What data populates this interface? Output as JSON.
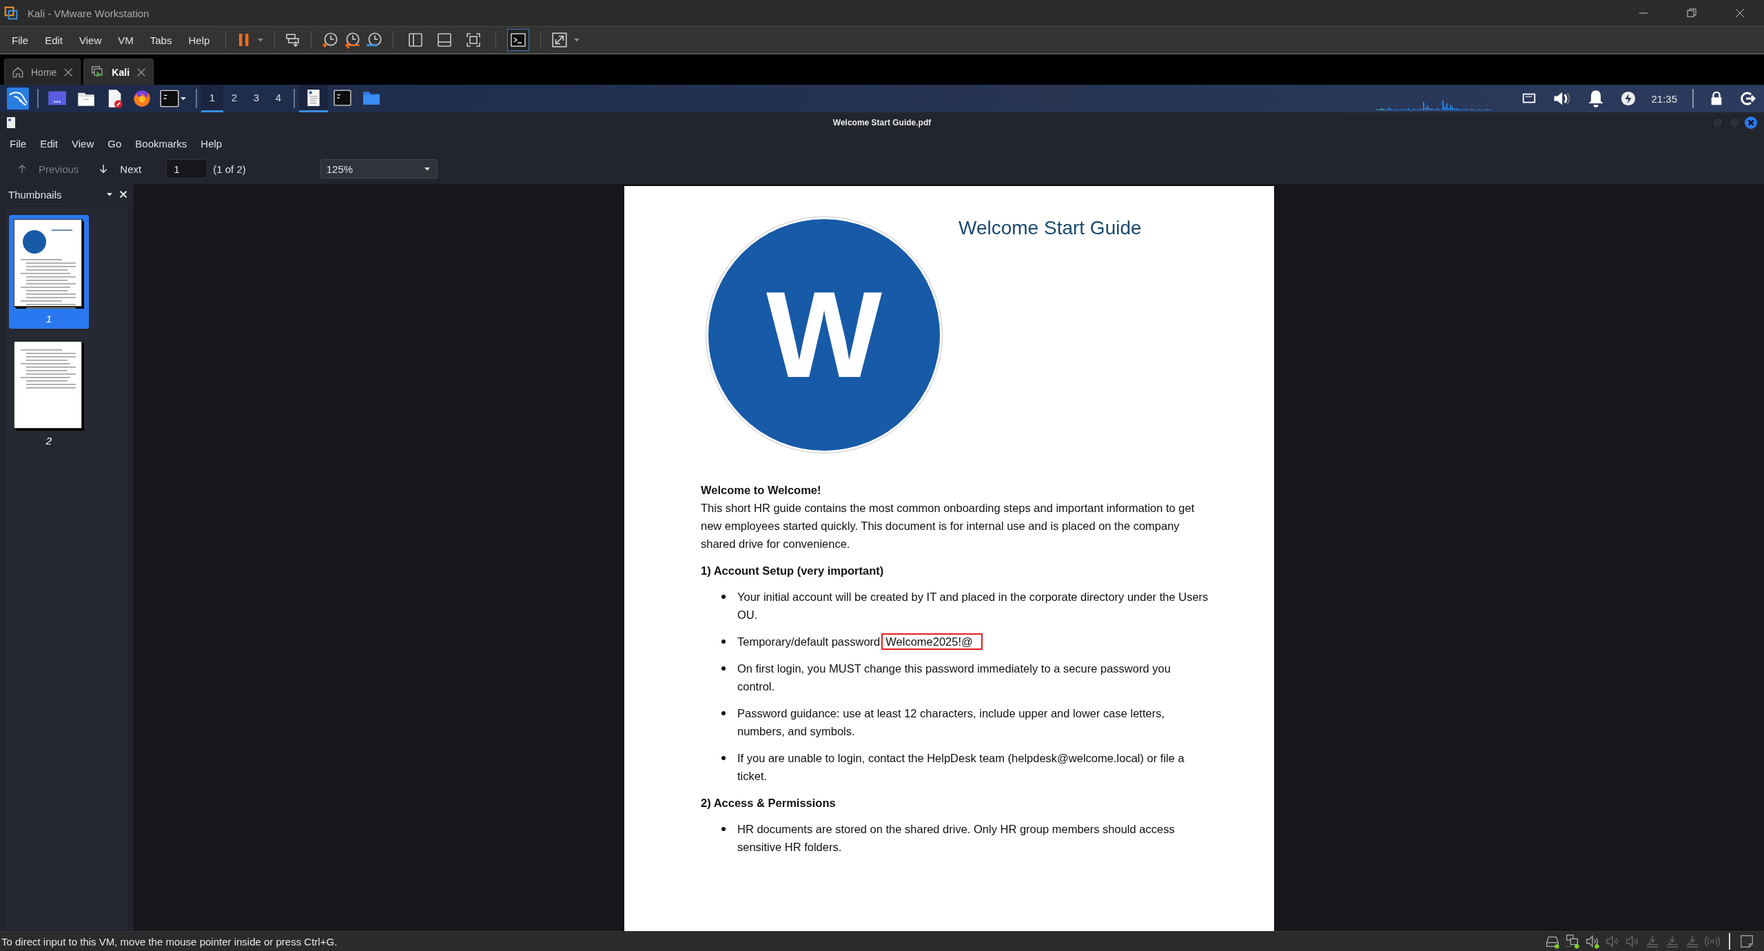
{
  "window": {
    "title": "Kali - VMware Workstation"
  },
  "menu": [
    "File",
    "Edit",
    "View",
    "VM",
    "Tabs",
    "Help"
  ],
  "vm_toolbar": {
    "view_buttons": [
      {
        "kind": "sidebar",
        "selected": false
      },
      {
        "kind": "bottom",
        "selected": false
      },
      {
        "kind": "fullscreen",
        "selected": false
      },
      {
        "kind": "console",
        "selected": true
      }
    ]
  },
  "vm_tabs": [
    {
      "kind": "home",
      "label": "Home",
      "selected": false
    },
    {
      "kind": "vm",
      "label": "Kali",
      "selected": true
    }
  ],
  "panel": {
    "workspaces": [
      {
        "label": "1",
        "selected": true
      },
      {
        "label": "2",
        "selected": false
      },
      {
        "label": "3",
        "selected": false
      },
      {
        "label": "4",
        "selected": false
      }
    ],
    "tasks": [
      {
        "kind": "document",
        "selected": true
      },
      {
        "kind": "terminal",
        "selected": false
      },
      {
        "kind": "folder",
        "selected": false
      }
    ],
    "clock": "21:35"
  },
  "viewer": {
    "title": "Welcome Start Guide.pdf",
    "menu": [
      "File",
      "Edit",
      "View",
      "Go",
      "Bookmarks",
      "Help"
    ],
    "previous": {
      "label": "Previous",
      "disabled": true
    },
    "next": {
      "label": "Next",
      "disabled": false
    },
    "page_field": "1",
    "page_count": "(1 of 2)",
    "zoom": "125%",
    "sidebar": {
      "title": "Thumbnails",
      "thumbnails": [
        {
          "kind": "cover",
          "label": "1",
          "selected": true
        },
        {
          "kind": "text",
          "label": "2",
          "selected": false
        }
      ]
    },
    "document": {
      "title": "Welcome Start Guide",
      "logo_letter": "W",
      "blocks": [
        {
          "kind": "heading",
          "text": "Welcome to Welcome!"
        },
        {
          "kind": "paragraph",
          "text": "This short HR guide contains the most common onboarding steps and important information to get new employees started quickly. This document is for internal use and is placed on the company shared drive for convenience."
        },
        {
          "kind": "heading",
          "text": "1) Account Setup (very important)"
        },
        {
          "kind": "bullets",
          "items": [
            {
              "text": "Your initial account will be created by IT and placed in the corporate directory under the Users OU."
            },
            {
              "text": "Temporary/default password",
              "highlight": "Welcome2025!@"
            },
            {
              "text": "On first login, you MUST change this password immediately to a secure password you control."
            },
            {
              "text": "Password guidance: use at least 12 characters, include upper and lower case letters, numbers, and symbols."
            },
            {
              "text": "If you are unable to login, contact the HelpDesk team (helpdesk@welcome.local) or file a ticket."
            }
          ]
        },
        {
          "kind": "heading",
          "text": "2) Access & Permissions"
        },
        {
          "kind": "bullets",
          "items": [
            {
              "text": "HR documents are stored on the shared drive. Only HR group members should access sensitive HR folders."
            }
          ]
        }
      ]
    }
  },
  "status_bar": {
    "text": "To direct input to this VM, move the mouse pointer inside or press Ctrl+G.",
    "devices": [
      {
        "kind": "disk",
        "connected": true
      },
      {
        "kind": "network",
        "connected": true
      },
      {
        "kind": "sound",
        "connected": true
      },
      {
        "kind": "sound",
        "connected": false
      },
      {
        "kind": "sound",
        "connected": false
      },
      {
        "kind": "usb",
        "connected": false
      },
      {
        "kind": "usb",
        "connected": false
      },
      {
        "kind": "usb",
        "connected": false
      },
      {
        "kind": "wireless",
        "connected": false
      }
    ]
  }
}
